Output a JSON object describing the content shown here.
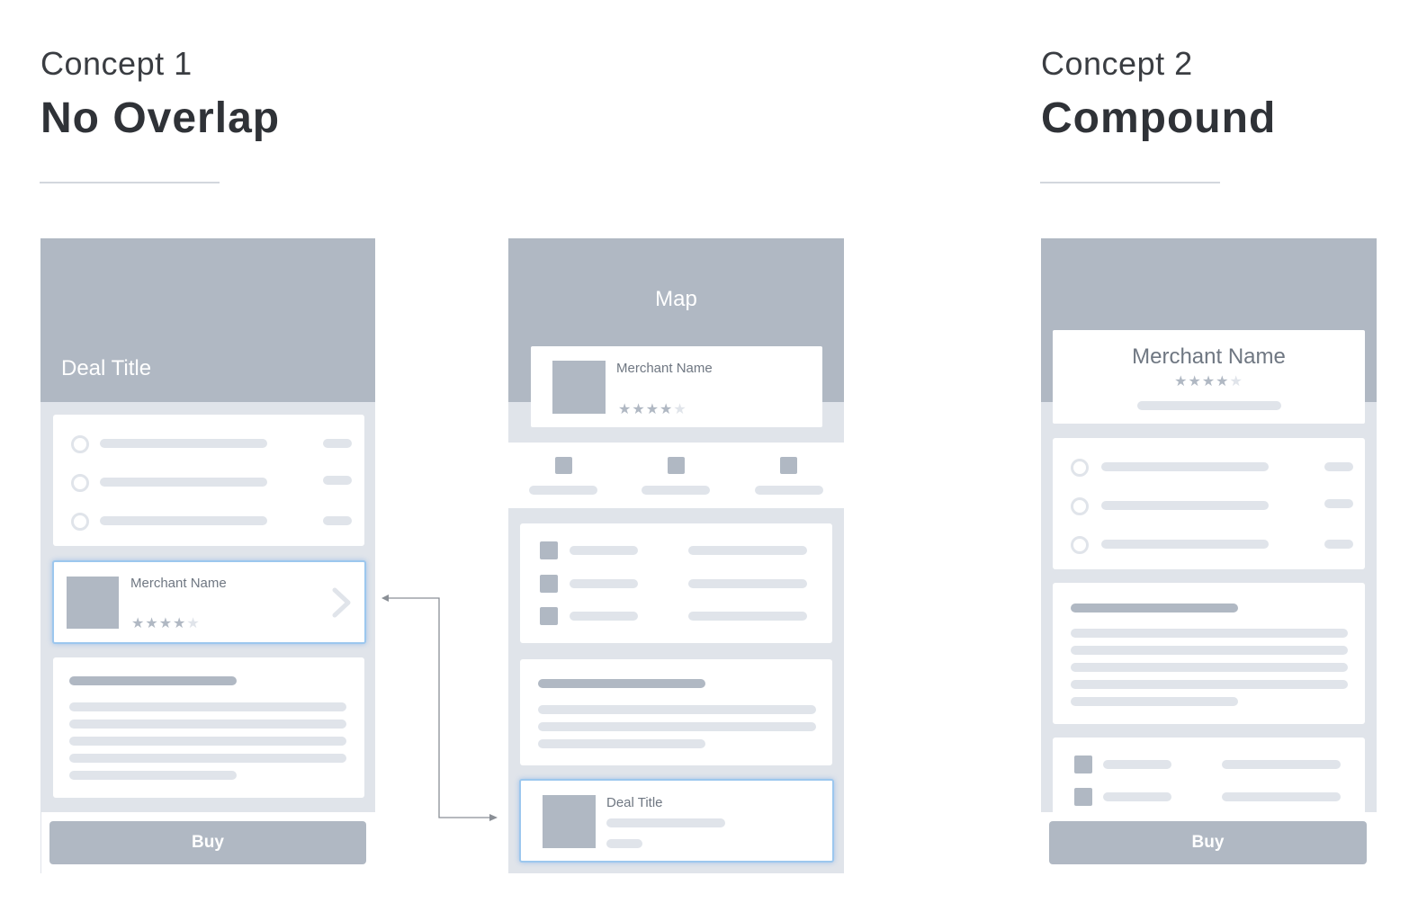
{
  "concept1": {
    "label": "Concept 1",
    "title": "No Overlap"
  },
  "concept2": {
    "label": "Concept 2",
    "title": "Compound"
  },
  "phone1": {
    "hero_title": "Deal Title",
    "merchant_card": {
      "name": "Merchant Name",
      "rating": 4,
      "max_rating": 5
    },
    "buy_label": "Buy"
  },
  "phone2": {
    "hero_title": "Map",
    "merchant_card": {
      "name": "Merchant Name",
      "rating": 4,
      "max_rating": 5
    },
    "deal_card": {
      "title": "Deal Title"
    }
  },
  "phone3": {
    "merchant_card": {
      "name": "Merchant Name",
      "rating": 4,
      "max_rating": 5
    },
    "buy_label": "Buy"
  },
  "colors": {
    "wire_dark": "#b0b8c3",
    "wire_light": "#e0e4ea",
    "highlight": "#9cc7ee",
    "arrow": "#8a8f96"
  },
  "icons": {
    "chevron": "chevron-right-icon",
    "star": "star-icon",
    "radio": "radio-icon",
    "arrow": "connector-arrow-icon"
  }
}
